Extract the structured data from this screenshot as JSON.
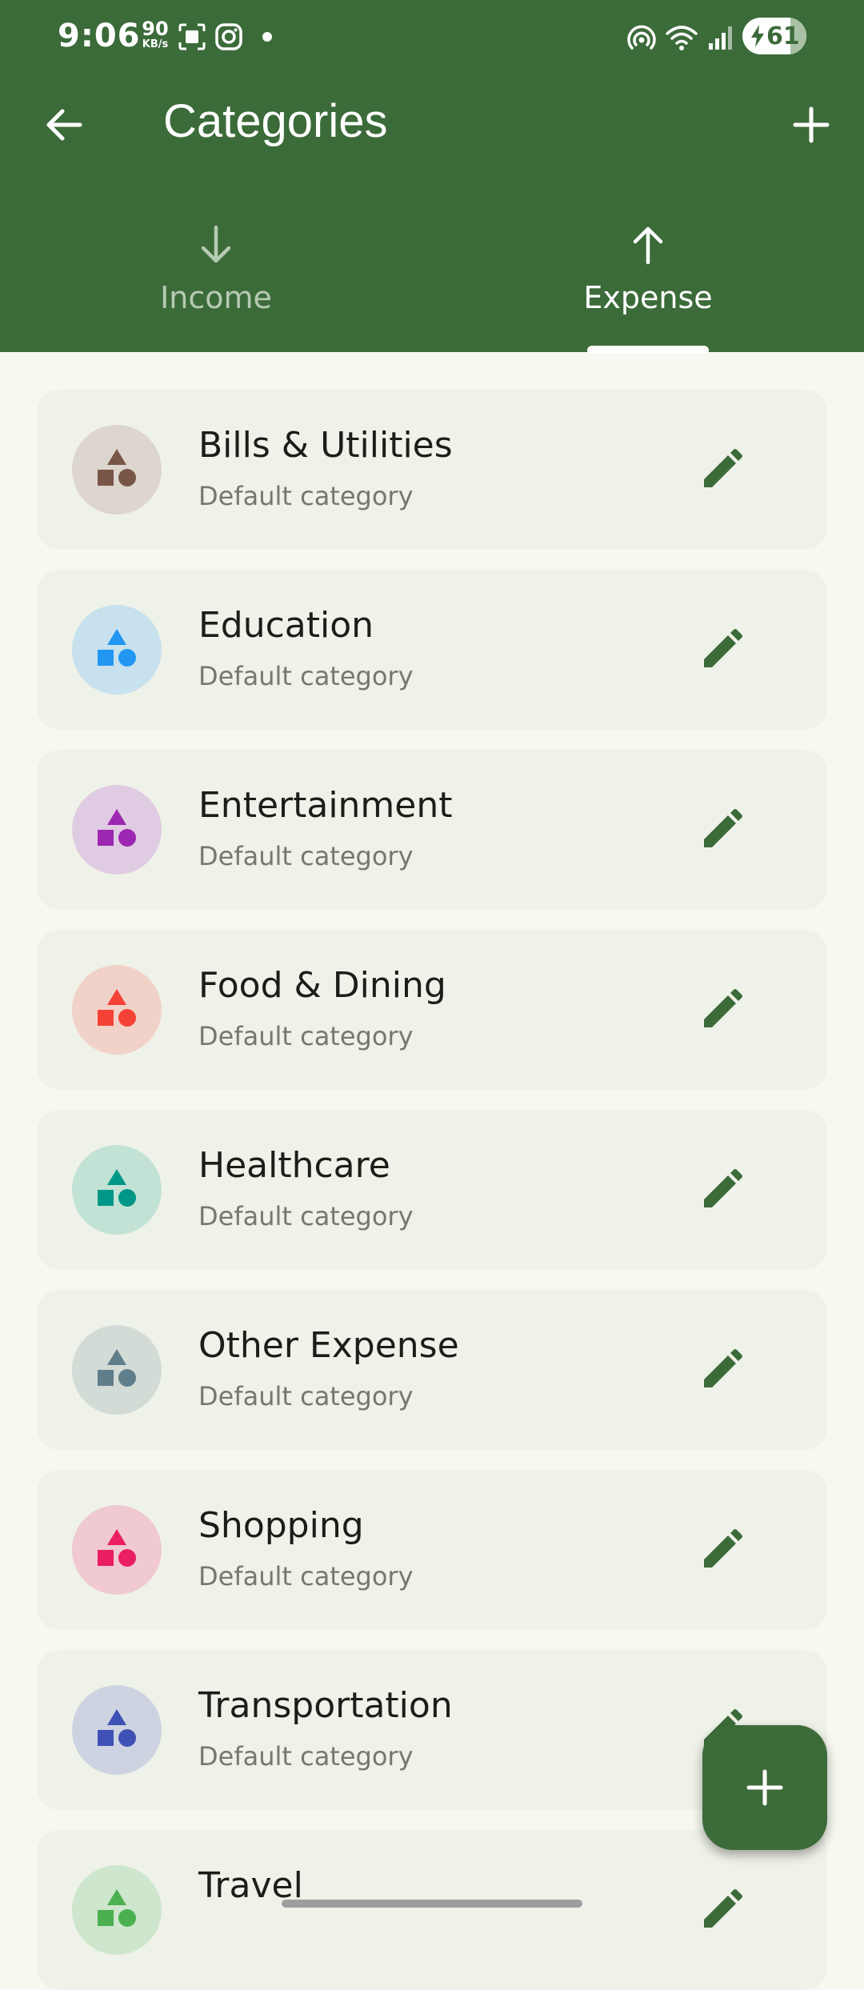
{
  "status_bar": {
    "time": "9:06",
    "net_speed_value": "90",
    "net_speed_unit": "KB/s",
    "battery": "61",
    "icons": [
      "screenshot-icon",
      "instagram-icon",
      "hotspot-icon",
      "wifi-icon",
      "signal-icon",
      "battery-icon"
    ]
  },
  "appbar": {
    "title": "Categories",
    "back_icon": "arrow-left-icon",
    "add_icon": "plus-icon"
  },
  "tabs": [
    {
      "label": "Income",
      "icon": "arrow-down-icon",
      "selected": false
    },
    {
      "label": "Expense",
      "icon": "arrow-up-icon",
      "selected": true
    }
  ],
  "categories": [
    {
      "name": "Bills & Utilities",
      "subtitle": "Default category",
      "color": "#795548",
      "bg": "#dcd6ce"
    },
    {
      "name": "Education",
      "subtitle": "Default category",
      "color": "#2196f3",
      "bg": "#c7e1ee"
    },
    {
      "name": "Entertainment",
      "subtitle": "Default category",
      "color": "#9c27b0",
      "bg": "#e0cce2"
    },
    {
      "name": "Food & Dining",
      "subtitle": "Default category",
      "color": "#f44336",
      "bg": "#f1d2c9"
    },
    {
      "name": "Healthcare",
      "subtitle": "Default category",
      "color": "#009688",
      "bg": "#c3e2d6"
    },
    {
      "name": "Other Expense",
      "subtitle": "Default category",
      "color": "#607d8b",
      "bg": "#d3dbd6"
    },
    {
      "name": "Shopping",
      "subtitle": "Default category",
      "color": "#e91e63",
      "bg": "#f0c9d1"
    },
    {
      "name": "Transportation",
      "subtitle": "Default category",
      "color": "#3f51b5",
      "bg": "#cdd3e1"
    },
    {
      "name": "Travel",
      "subtitle": "",
      "color": "#4caf50",
      "bg": "#cde6cd"
    }
  ],
  "fab": {
    "icon": "plus-icon"
  },
  "colors": {
    "primary": "#3c6b3a",
    "background": "#f7f9f1",
    "card": "#eff2e8"
  }
}
